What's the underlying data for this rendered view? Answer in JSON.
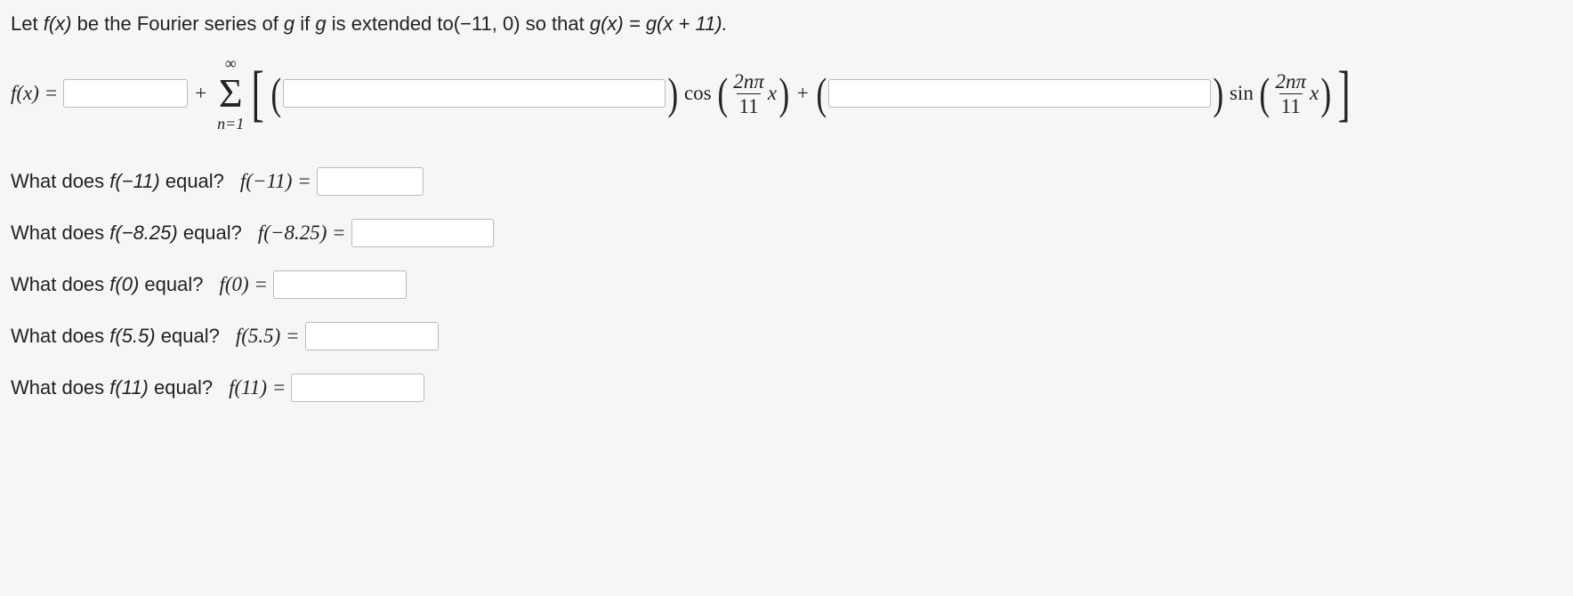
{
  "prompt": {
    "pre1": "Let ",
    "fx": "f(x)",
    "pre2": " be the Fourier series of ",
    "g": "g",
    "pre3": " if ",
    "g2": "g",
    "pre4": " is extended to",
    "interval": "(−11, 0)",
    "pre5": " so that ",
    "gx": "g(x) = g(x + 11).",
    "end": ""
  },
  "formula": {
    "fx": "f(x) = ",
    "plus": " + ",
    "sum_top": "∞",
    "sum_sym": "Σ",
    "sum_bot": "n=1",
    "cos": "cos",
    "sin": "sin",
    "frac_num": "2nπ",
    "frac_den": "11",
    "x": "x"
  },
  "questions": [
    {
      "label_pre": "What does ",
      "fn": "f(−11)",
      "label_post": " equal?",
      "eq": "f(−11) = ",
      "box_class": "w-small"
    },
    {
      "label_pre": "What does ",
      "fn": "f(−8.25)",
      "label_post": " equal?",
      "eq": "f(−8.25) = ",
      "box_class": "w-large"
    },
    {
      "label_pre": "What does ",
      "fn": "f(0)",
      "label_post": " equal?",
      "eq": "f(0) = ",
      "box_class": "w-med"
    },
    {
      "label_pre": "What does ",
      "fn": "f(5.5)",
      "label_post": " equal?",
      "eq": "f(5.5) = ",
      "box_class": "w-med"
    },
    {
      "label_pre": "What does ",
      "fn": "f(11)",
      "label_post": " equal?",
      "eq": "f(11) = ",
      "box_class": "w-med"
    }
  ]
}
